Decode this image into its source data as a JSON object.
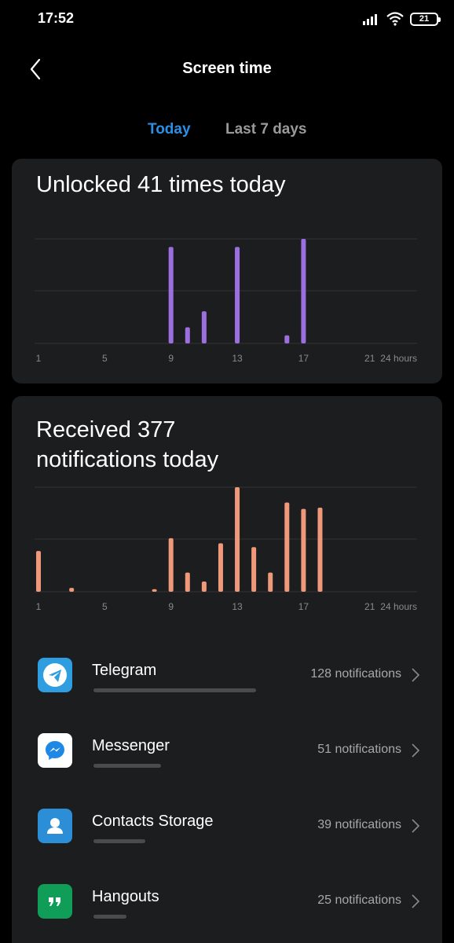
{
  "status_bar": {
    "time": "17:52",
    "battery": "21",
    "icons": [
      "signal-icon",
      "wifi-icon",
      "battery-icon"
    ]
  },
  "header": {
    "title": "Screen time",
    "back_icon": "back-arrow-icon"
  },
  "tabs": [
    {
      "label": "Today",
      "active": true
    },
    {
      "label": "Last 7 days",
      "active": false
    }
  ],
  "colors": {
    "accent": "#2b8fe6",
    "unlock_bar": "#9b6fe0",
    "notif_bar": "#f0987a",
    "card_bg": "#1c1d1e",
    "gridline": "#333436",
    "tick_label": "#8a8a8a"
  },
  "unlocks": {
    "title": "Unlocked 41 times today"
  },
  "notifications": {
    "title": "Received 377\nnotifications today"
  },
  "chart_data": [
    {
      "type": "bar",
      "x_tick_labels": [
        "1",
        "5",
        "9",
        "13",
        "17",
        "21"
      ],
      "x_unit_label": "24 hours",
      "grid": true,
      "x": [
        9,
        10,
        11,
        13,
        16,
        17
      ],
      "values": [
        12,
        2,
        4,
        12,
        1,
        13
      ],
      "ylim": [
        0,
        13
      ]
    },
    {
      "type": "bar",
      "x_tick_labels": [
        "1",
        "5",
        "9",
        "13",
        "17",
        "21"
      ],
      "x_unit_label": "24 hours",
      "grid": true,
      "x": [
        1,
        3,
        8,
        9,
        10,
        11,
        12,
        13,
        14,
        15,
        16,
        17,
        18
      ],
      "values": [
        32,
        3,
        2,
        42,
        15,
        8,
        38,
        82,
        35,
        15,
        70,
        65,
        66
      ],
      "ylim": [
        0,
        82
      ]
    }
  ],
  "apps": [
    {
      "name": "Telegram",
      "count_label": "128 notifications",
      "count": 128,
      "icon": "telegram-icon",
      "icon_bg": "#2e9ee0"
    },
    {
      "name": "Messenger",
      "count_label": "51 notifications",
      "count": 51,
      "icon": "messenger-icon",
      "icon_bg": "#ffffff"
    },
    {
      "name": "Contacts Storage",
      "count_label": "39 notifications",
      "count": 39,
      "icon": "contacts-icon",
      "icon_bg": "#2d8ed8"
    },
    {
      "name": "Hangouts",
      "count_label": "25 notifications",
      "count": 25,
      "icon": "hangouts-icon",
      "icon_bg": "#0f9d58"
    }
  ]
}
